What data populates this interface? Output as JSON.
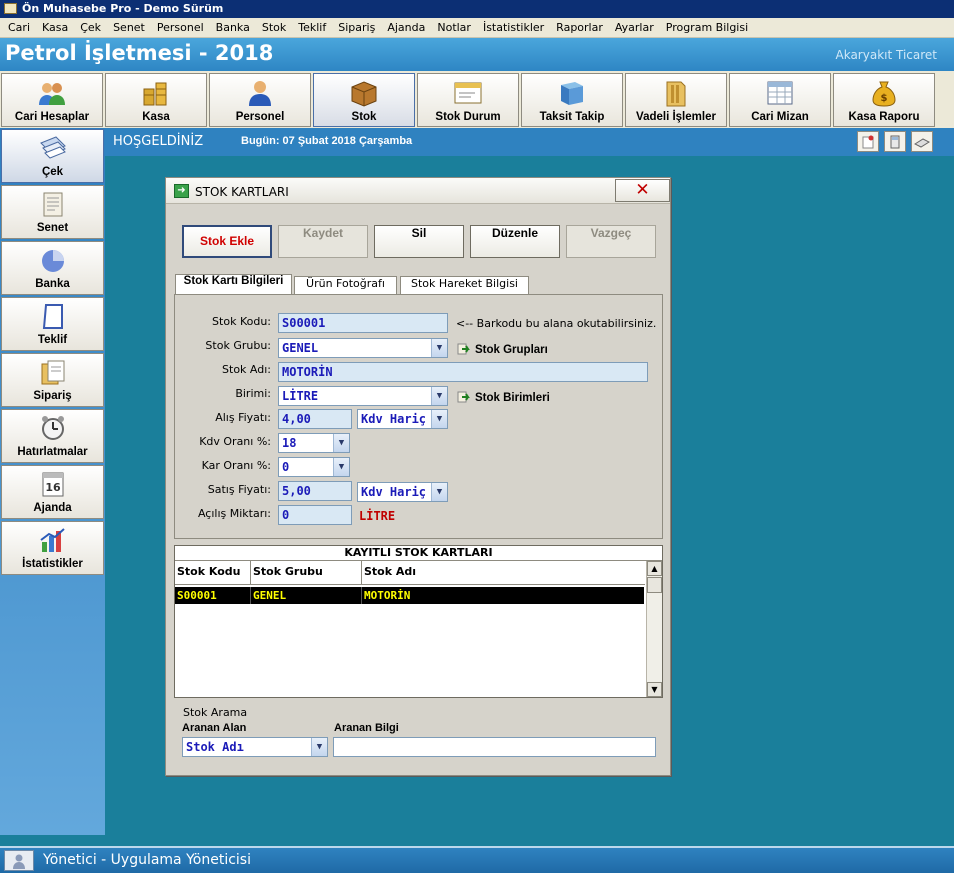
{
  "window": {
    "title": "Ön Muhasebe Pro - Demo Sürüm"
  },
  "menu": [
    "Cari",
    "Kasa",
    "Çek",
    "Senet",
    "Personel",
    "Banka",
    "Stok",
    "Teklif",
    "Sipariş",
    "Ajanda",
    "Notlar",
    "İstatistikler",
    "Raporlar",
    "Ayarlar",
    "Program Bilgisi"
  ],
  "header": {
    "title": "Petrol İşletmesi - 2018",
    "subtitle": "Akaryakıt Ticaret"
  },
  "toolbar": [
    {
      "label": "Cari Hesaplar",
      "icon": "users-icon"
    },
    {
      "label": "Kasa",
      "icon": "coins-icon"
    },
    {
      "label": "Personel",
      "icon": "person-icon"
    },
    {
      "label": "Stok",
      "icon": "box-icon"
    },
    {
      "label": "Stok Durum",
      "icon": "window-icon"
    },
    {
      "label": "Taksit Takip",
      "icon": "book-icon"
    },
    {
      "label": "Vadeli İşlemler",
      "icon": "folder-icon"
    },
    {
      "label": "Cari Mizan",
      "icon": "spreadsheet-icon"
    },
    {
      "label": "Kasa Raporu",
      "icon": "money-bag-icon"
    }
  ],
  "sidebar": [
    {
      "label": "Çek",
      "icon": "check-book-icon"
    },
    {
      "label": "Senet",
      "icon": "document-icon"
    },
    {
      "label": "Banka",
      "icon": "pie-chart-icon"
    },
    {
      "label": "Teklif",
      "icon": "paper-icon"
    },
    {
      "label": "Sipariş",
      "icon": "order-icon"
    },
    {
      "label": "Hatırlatmalar",
      "icon": "alarm-clock-icon"
    },
    {
      "label": "Ajanda",
      "icon": "calendar-icon"
    },
    {
      "label": "İstatistikler",
      "icon": "bar-chart-icon"
    }
  ],
  "welcome": {
    "greeting": "HOŞGELDİNİZ",
    "date": "Bugün: 07 Şubat 2018 Çarşamba"
  },
  "dialog": {
    "title": "STOK KARTLARI",
    "buttons": {
      "add": "Stok Ekle",
      "save": "Kaydet",
      "delete": "Sil",
      "edit": "Düzenle",
      "cancel": "Vazgeç"
    },
    "tabs": [
      "Stok Kartı Bilgileri",
      "Ürün Fotoğrafı",
      "Stok Hareket Bilgisi"
    ],
    "form": {
      "stok_kodu_label": "Stok Kodu:",
      "stok_kodu": "S00001",
      "barcode_hint": "<-- Barkodu bu alana okutabilirsiniz.",
      "stok_grubu_label": "Stok Grubu:",
      "stok_grubu": "GENEL",
      "stok_gruplari_link": "Stok Grupları",
      "stok_adi_label": "Stok Adı:",
      "stok_adi": "MOTORİN",
      "birimi_label": "Birimi:",
      "birimi": "LİTRE",
      "stok_birimleri_link": "Stok Birimleri",
      "alis_fiyati_label": "Alış Fiyatı:",
      "alis_fiyati": "4,00",
      "alis_kdv": "Kdv Hariç",
      "kdv_orani_label": "Kdv Oranı %:",
      "kdv_orani": "18",
      "kar_orani_label": "Kar Oranı %:",
      "kar_orani": "0",
      "satis_fiyati_label": "Satış Fiyatı:",
      "satis_fiyati": "5,00",
      "satis_kdv": "Kdv Hariç",
      "acilis_miktari_label": "Açılış Miktarı:",
      "acilis_miktari": "0",
      "acilis_birim": "LİTRE"
    },
    "grid": {
      "title": "KAYITLI STOK KARTLARI",
      "columns": [
        "Stok Kodu",
        "Stok Grubu",
        "Stok Adı"
      ],
      "rows": [
        [
          "S00001",
          "GENEL",
          "MOTORİN"
        ]
      ]
    },
    "search": {
      "group_label": "Stok Arama",
      "field_label": "Aranan Alan",
      "field_value": "Stok Adı",
      "info_label": "Aranan Bilgi",
      "info_value": ""
    }
  },
  "status": {
    "user": "Yönetici - Uygulama Yöneticisi"
  },
  "colors": {
    "accent": "#2e86c4",
    "background": "#1a7f9b",
    "grid_selected_bg": "#000000",
    "grid_selected_fg": "#ffff00",
    "danger": "#d00000"
  }
}
